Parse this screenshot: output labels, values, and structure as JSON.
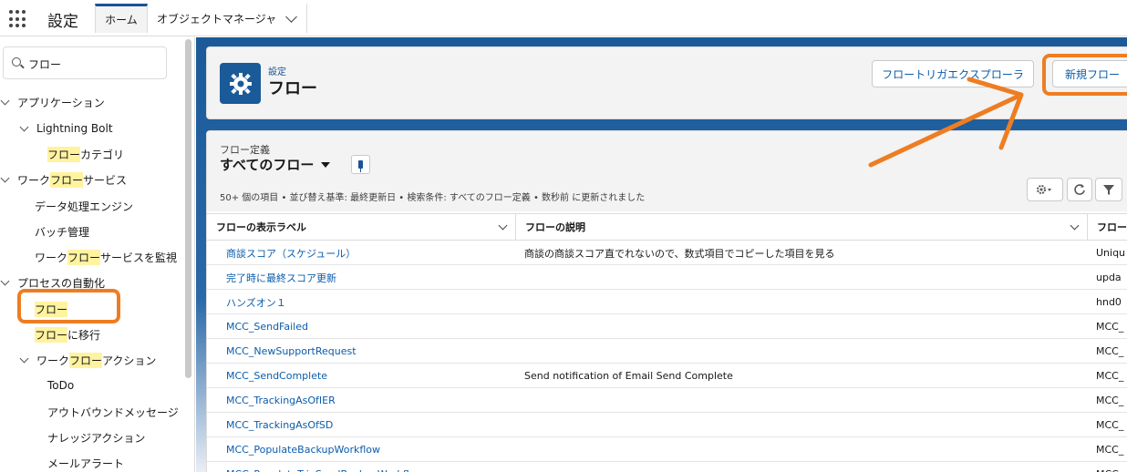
{
  "app": {
    "name": "設定"
  },
  "tabs": [
    {
      "label": "ホーム"
    },
    {
      "label": "オブジェクトマネージャ"
    }
  ],
  "sidebar": {
    "search_value": "フロー",
    "items": [
      {
        "prefix": "",
        "highlight": "",
        "suffix": "アプリケーション"
      },
      {
        "prefix": "",
        "highlight": "",
        "suffix": "Lightning Bolt"
      },
      {
        "prefix": "",
        "highlight": "フロー",
        "suffix": "カテゴリ"
      },
      {
        "prefix": "ワーク",
        "highlight": "フロー",
        "suffix": "サービス"
      },
      {
        "prefix": "",
        "highlight": "",
        "suffix": "データ処理エンジン"
      },
      {
        "prefix": "",
        "highlight": "",
        "suffix": "バッチ管理"
      },
      {
        "prefix": "ワーク",
        "highlight": "フロー",
        "suffix": "サービスを監視"
      },
      {
        "prefix": "",
        "highlight": "",
        "suffix": "プロセスの自動化"
      },
      {
        "prefix": "",
        "highlight": "フロー",
        "suffix": ""
      },
      {
        "prefix": "",
        "highlight": "フロー",
        "suffix": "に移行"
      },
      {
        "prefix": "ワーク",
        "highlight": "フロー",
        "suffix": "アクション"
      },
      {
        "prefix": "",
        "highlight": "",
        "suffix": "ToDo"
      },
      {
        "prefix": "",
        "highlight": "",
        "suffix": "アウトバウンドメッセージ"
      },
      {
        "prefix": "",
        "highlight": "",
        "suffix": "ナレッジアクション"
      },
      {
        "prefix": "",
        "highlight": "",
        "suffix": "メールアラート"
      }
    ]
  },
  "header": {
    "breadcrumb": "設定",
    "title": "フロー",
    "explorer_button": "フロートリガエクスプローラ",
    "new_button": "新規フロー"
  },
  "list": {
    "object_label": "フロー定義",
    "view_name": "すべてのフロー",
    "meta": "50+ 個の項目 • 並び替え基準: 最終更新日 • 検索条件: すべてのフロー定義 • 数秒前 に更新されました",
    "columns": [
      "フローの表示ラベル",
      "フローの説明",
      "フロー"
    ],
    "rows": [
      {
        "label": "商談スコア（スケジュール）",
        "desc": "商談の商談スコア直でれないので、数式項目でコピーした項目を見る",
        "api": "Uniqu"
      },
      {
        "label": "完了時に最終スコア更新",
        "desc": "",
        "api": "upda"
      },
      {
        "label": "ハンズオン１",
        "desc": "",
        "api": "hnd0"
      },
      {
        "label": "MCC_SendFailed",
        "desc": "",
        "api": "MCC_"
      },
      {
        "label": "MCC_NewSupportRequest",
        "desc": "",
        "api": "MCC_"
      },
      {
        "label": "MCC_SendComplete",
        "desc": "Send notification of Email Send Complete",
        "api": "MCC_"
      },
      {
        "label": "MCC_TrackingAsOfIER",
        "desc": "",
        "api": "MCC_"
      },
      {
        "label": "MCC_TrackingAsOfSD",
        "desc": "",
        "api": "MCC_"
      },
      {
        "label": "MCC_PopulateBackupWorkflow",
        "desc": "",
        "api": "MCC_"
      },
      {
        "label": "MCC_PopulateTrigSendBackupWorkflow",
        "desc": "",
        "api": "MCC_"
      }
    ]
  },
  "colors": {
    "accent": "#ee7d22",
    "brand": "#1b5a99",
    "link": "#0b5cab",
    "highlight": "#fff3a0"
  }
}
